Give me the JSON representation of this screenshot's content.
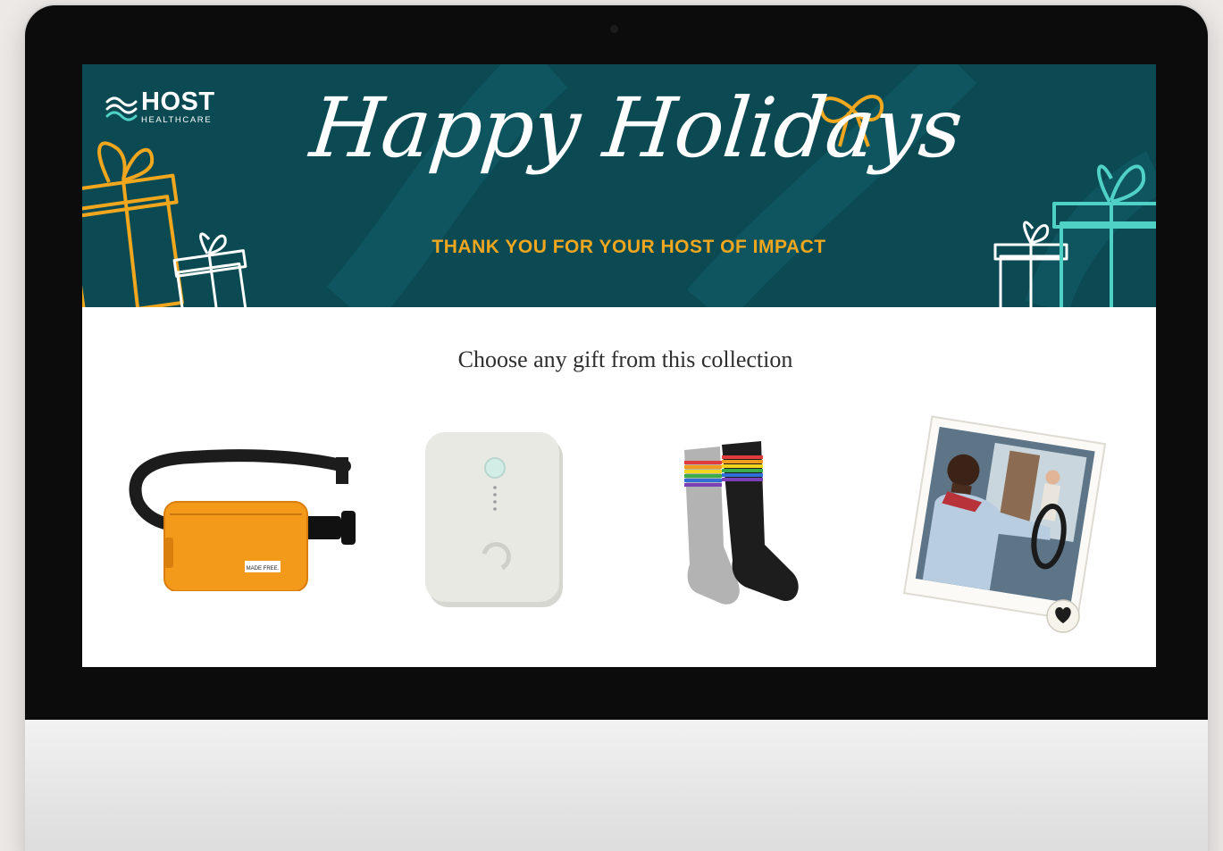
{
  "banner": {
    "logo": {
      "name": "HOST",
      "subname": "HEALTHCARE"
    },
    "headline": "Happy Holidays",
    "tagline": "THANK YOU FOR YOUR HOST OF IMPACT"
  },
  "main": {
    "prompt": "Choose any gift from this collection",
    "products": [
      {
        "icon": "orange-belt-bag",
        "label_on_item": "MADE FREE."
      },
      {
        "icon": "portable-charger"
      },
      {
        "icon": "rainbow-striped-socks"
      },
      {
        "icon": "donation-photo-card",
        "badge_icon": "heart-badge-icon"
      }
    ]
  },
  "colors": {
    "banner_bg": "#0b4a52",
    "gold": "#f0a71e",
    "teal_accent": "#4fd1c5",
    "bag_orange": "#f39a1b"
  }
}
